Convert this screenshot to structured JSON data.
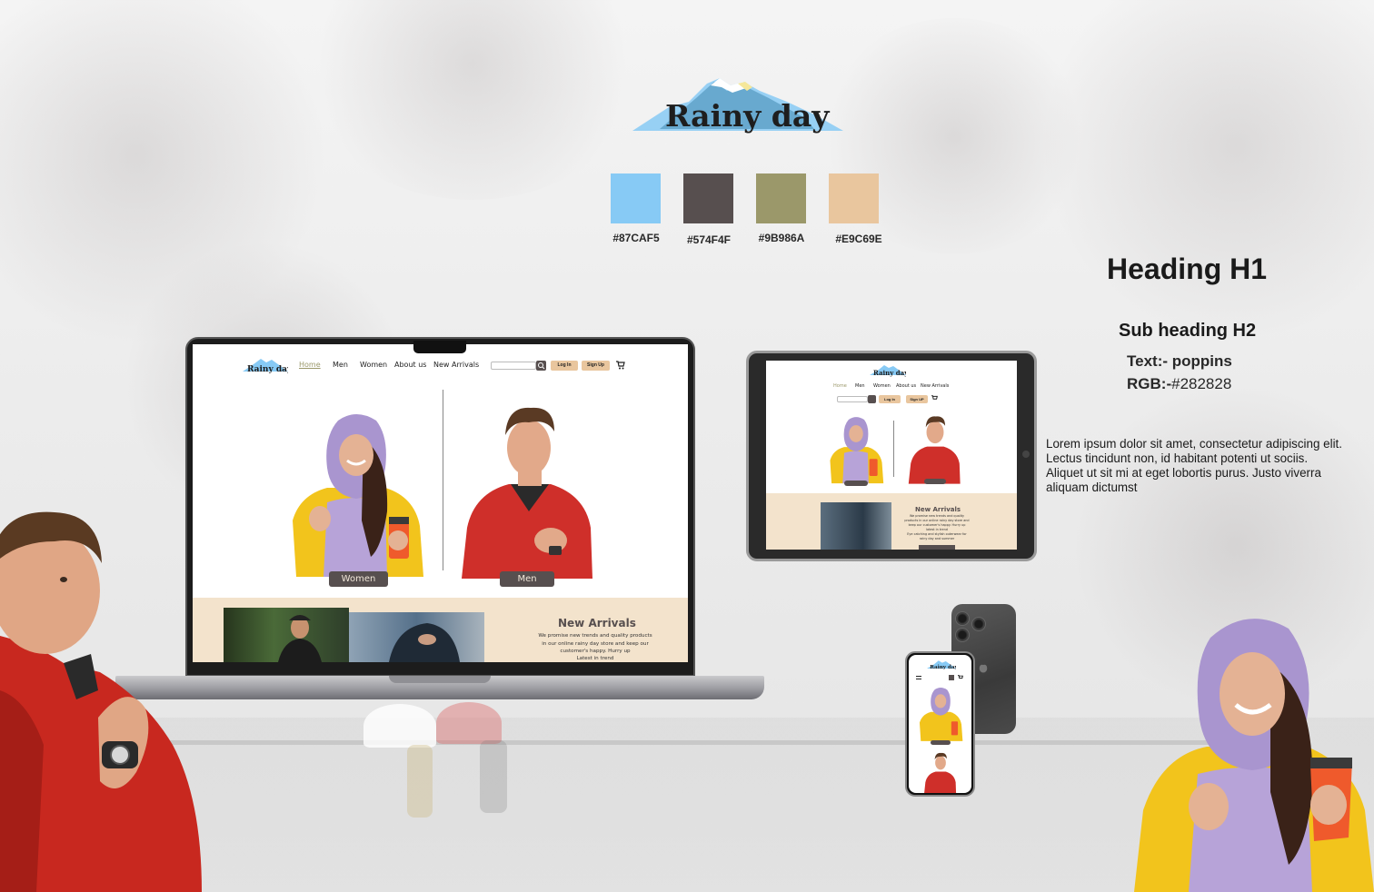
{
  "brand": {
    "name": "Rainy day"
  },
  "palette": [
    {
      "hex": "#87CAF5",
      "label": "#87CAF5"
    },
    {
      "hex": "#574F4F",
      "label": "#574F4F"
    },
    {
      "hex": "#9B986A",
      "label": "#9B986A"
    },
    {
      "hex": "#E9C69E",
      "label": "#E9C69E"
    }
  ],
  "typography": {
    "heading_h1": "Heading H1",
    "sub_heading_h2": "Sub heading H2",
    "text_label": "Text:-",
    "text_value": "poppins",
    "rgb_label": "RGB:-",
    "rgb_value": "#282828",
    "lorem": "Lorem ipsum dolor sit amet, consectetur adipiscing elit. Lectus tincidunt non, id habitant potenti ut sociis. Aliquet ut sit mi at eget lobortis purus. Justo viverra aliquam dictumst"
  },
  "site": {
    "nav": [
      "Home",
      "Men",
      "Women",
      "About us",
      "New Arrivals"
    ],
    "login_label": "Log In",
    "signup_label": "Sign Up",
    "cart_icon": "cart-icon",
    "search_icon": "search-icon",
    "women_label": "Women",
    "men_label": "Men",
    "new_arrivals_title": "New Arrivals",
    "new_arrivals_text": "We promise new trends and quality products in our online rainy day store and keep our customer's happy. Hurry up",
    "new_arrivals_text_2": "Latest in trend",
    "tablet_signup_label": "Sign UP",
    "tablet_arrivals_line_2": "latest in trend",
    "tablet_arrivals_line_3": "Eye catching and stylish outerwear for rainy day and summer"
  },
  "colors": {
    "accent_blue": "#87CAF5",
    "dark": "#574F4F",
    "olive": "#9B986A",
    "beige": "#E9C69E",
    "text": "#282828"
  }
}
